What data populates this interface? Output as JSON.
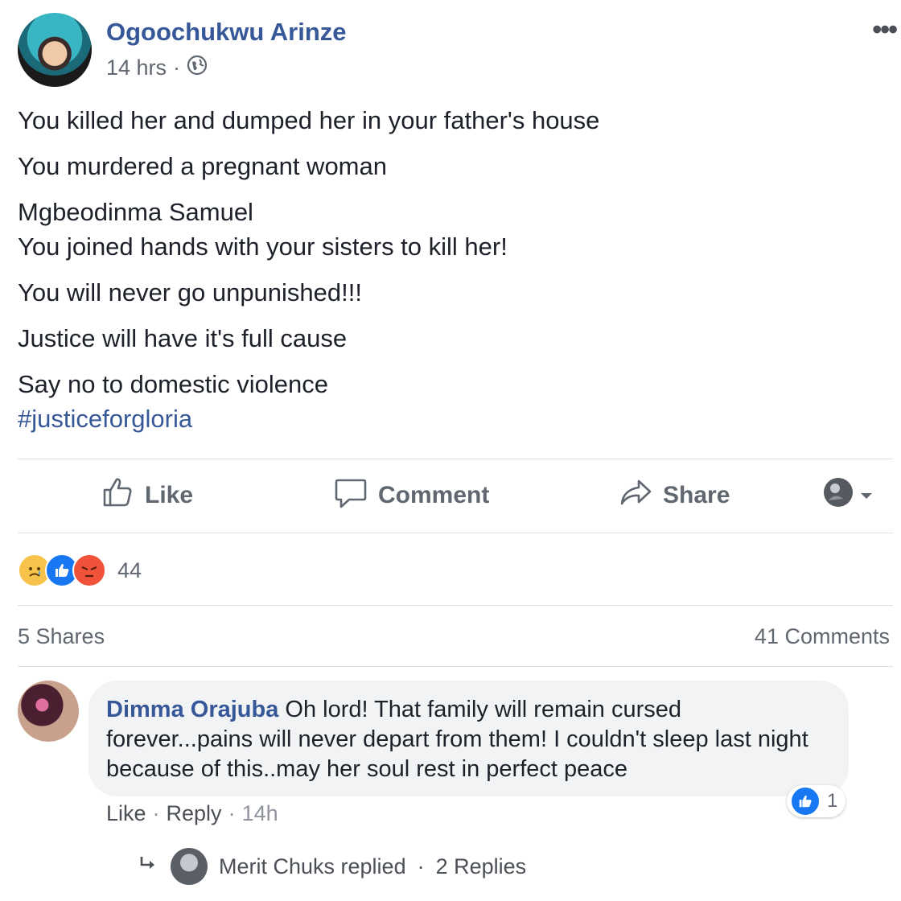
{
  "post": {
    "author": "Ogoochukwu Arinze",
    "time": "14 hrs",
    "separator": "·",
    "privacy_icon": "globe-icon",
    "more_label": "•••",
    "lines": [
      "You killed her and dumped her in your father's house",
      "You murdered a pregnant woman",
      "Mgbeodinma Samuel",
      "You joined hands with your sisters to kill her!",
      "You will never go unpunished!!!",
      "Justice will have it's full cause",
      "Say no to domestic violence"
    ],
    "hashtag": "#justiceforgloria"
  },
  "actions": {
    "like": "Like",
    "comment": "Comment",
    "share": "Share"
  },
  "reactions": {
    "icons": [
      "sad-reaction-icon",
      "like-reaction-icon",
      "angry-reaction-icon"
    ],
    "count": "44"
  },
  "stats": {
    "shares": "5 Shares",
    "comments": "41 Comments"
  },
  "comment": {
    "author": "Dimma Orajuba",
    "text": " Oh lord! That family will remain cursed forever...pains will never depart from them! I couldn't sleep last night because of this..may her soul rest in perfect peace",
    "like_count": "1",
    "like": "Like",
    "reply": "Reply",
    "time": "14h",
    "dot": "·"
  },
  "replies": {
    "text": "Merit Chuks replied",
    "dot": "·",
    "count": "2 Replies"
  },
  "colors": {
    "link": "#365899",
    "text": "#1d2129",
    "muted": "#616770",
    "like_blue": "#1877f2",
    "angry": "#f0533a",
    "sad": "#f7c34a"
  }
}
